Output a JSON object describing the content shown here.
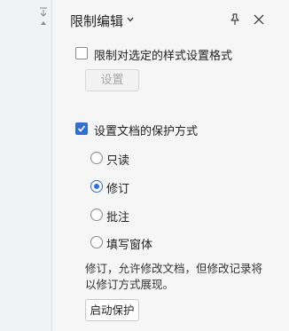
{
  "panel": {
    "title": "限制编辑"
  },
  "format_restriction": {
    "checkbox_label": "限制对选定的样式设置格式",
    "checked": false,
    "settings_button": "设置"
  },
  "protection": {
    "checkbox_label": "设置文档的保护方式",
    "checked": true,
    "options": [
      {
        "label": "只读",
        "selected": false
      },
      {
        "label": "修订",
        "selected": true
      },
      {
        "label": "批注",
        "selected": false
      },
      {
        "label": "填写窗体",
        "selected": false
      }
    ],
    "description": "修订，允许修改文档，但修改记录将以修订方式展现。",
    "start_button": "启动保护"
  },
  "colors": {
    "accent": "#2f6fd6"
  }
}
